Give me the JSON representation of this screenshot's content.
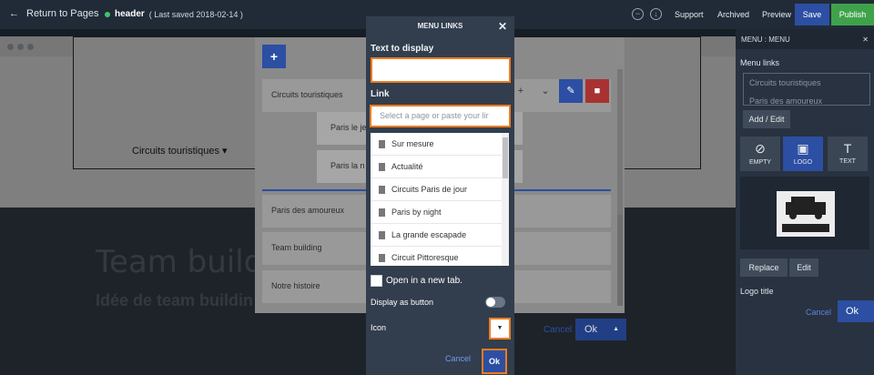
{
  "topbar": {
    "back_label": "Return to Pages",
    "page_name": "header",
    "saved_text": "( Last saved 2018-02-14 )",
    "support": "Support",
    "archived": "Archived",
    "preview": "Preview",
    "save": "Save",
    "publish": "Publish"
  },
  "background_page": {
    "nav_item": "Circuits touristiques",
    "hero_title": "Team buildi",
    "hero_subtitle": "Idée de team buildin"
  },
  "menu_editor": {
    "items": [
      {
        "label": "Circuits touristiques"
      },
      {
        "label": "Paris le je"
      },
      {
        "label": "Paris la n"
      },
      {
        "label": "Paris des amoureux"
      },
      {
        "label": "Team building"
      },
      {
        "label": "Notre histoire"
      }
    ],
    "cancel": "Cancel",
    "ok": "Ok"
  },
  "sidebar": {
    "title": "MENU : MENU",
    "menu_links_label": "Menu links",
    "links": [
      "Circuits touristiques",
      "Paris des amoureux"
    ],
    "add_edit": "Add / Edit",
    "tiles": [
      {
        "icon": "ban-icon",
        "label": "EMPTY"
      },
      {
        "icon": "logo-icon",
        "label": "LOGO"
      },
      {
        "icon": "text-icon",
        "label": "TEXT"
      }
    ],
    "logo_alt_text": "CITY WHEELS",
    "replace": "Replace",
    "edit": "Edit",
    "logo_title_label": "Logo title",
    "cancel": "Cancel",
    "ok": "Ok"
  },
  "modal": {
    "title": "MENU LINKS",
    "text_label": "Text to display",
    "text_value": "",
    "link_label": "Link",
    "link_placeholder": "Select a page or paste your lir",
    "pages": [
      "Sur mesure",
      "Actualité",
      "Circuits Paris de jour",
      "Paris by night",
      "La grande escapade",
      "Circuit Pittoresque"
    ],
    "open_new_tab": "Open in a new tab.",
    "display_as_button": "Display as button",
    "icon_label": "Icon",
    "cancel": "Cancel",
    "ok": "Ok"
  },
  "colors": {
    "accent_blue": "#2c4fa3",
    "publish_green": "#3fa24b",
    "highlight_orange": "#f07b20"
  }
}
